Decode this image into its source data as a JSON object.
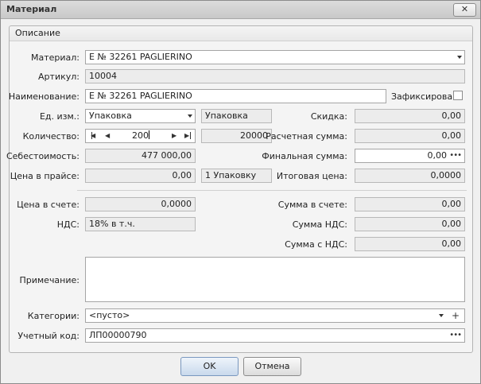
{
  "window": {
    "title": "Материал",
    "close_glyph": "✕"
  },
  "group": {
    "title": "Описание"
  },
  "fields": {
    "material": {
      "label": "Материал:",
      "value": "E № 32261 PAGLIERINO"
    },
    "article": {
      "label": "Артикул:",
      "value": "10004"
    },
    "name": {
      "label": "Наименование:",
      "value": "E № 32261 PAGLIERINO"
    },
    "fixed": {
      "label": "Зафиксирован",
      "checked": false
    },
    "unit": {
      "label": "Ед. изм.:",
      "value": "Упаковка",
      "display": "Упаковка"
    },
    "discount": {
      "label": "Скидка:",
      "value": "0,00"
    },
    "quantity": {
      "label": "Количество:",
      "value": "200",
      "total": "20000"
    },
    "calc_sum": {
      "label": "Расчетная сумма:",
      "value": "0,00"
    },
    "cost": {
      "label": "Себестоимость:",
      "value": "477 000,00"
    },
    "final_sum": {
      "label": "Финальная сумма:",
      "value": "0,00"
    },
    "price_list": {
      "label": "Цена в прайсе:",
      "value": "0,00",
      "unit": "1 Упаковку"
    },
    "total_price": {
      "label": "Итоговая цена:",
      "value": "0,0000"
    },
    "invoice_price": {
      "label": "Цена в счете:",
      "value": "0,0000"
    },
    "invoice_sum": {
      "label": "Сумма в счете:",
      "value": "0,00"
    },
    "vat": {
      "label": "НДС:",
      "value": "18% в т.ч."
    },
    "vat_sum": {
      "label": "Сумма НДС:",
      "value": "0,00"
    },
    "sum_with_vat": {
      "label": "Сумма с НДС:",
      "value": "0,00"
    },
    "note": {
      "label": "Примечание:",
      "value": ""
    },
    "categories": {
      "label": "Категории:",
      "value": "<пусто>"
    },
    "account_code": {
      "label": "Учетный код:",
      "value": "ЛП00000790"
    }
  },
  "buttons": {
    "ok": "OK",
    "cancel": "Отмена"
  },
  "icons": {
    "dropdown": "chevron-down-icon",
    "ellipsis": "ellipsis-icon",
    "plus": "plus-icon",
    "spin_first": "skip-back-icon",
    "spin_prev": "step-left-icon",
    "spin_next": "step-right-icon",
    "spin_last": "skip-forward-icon"
  }
}
